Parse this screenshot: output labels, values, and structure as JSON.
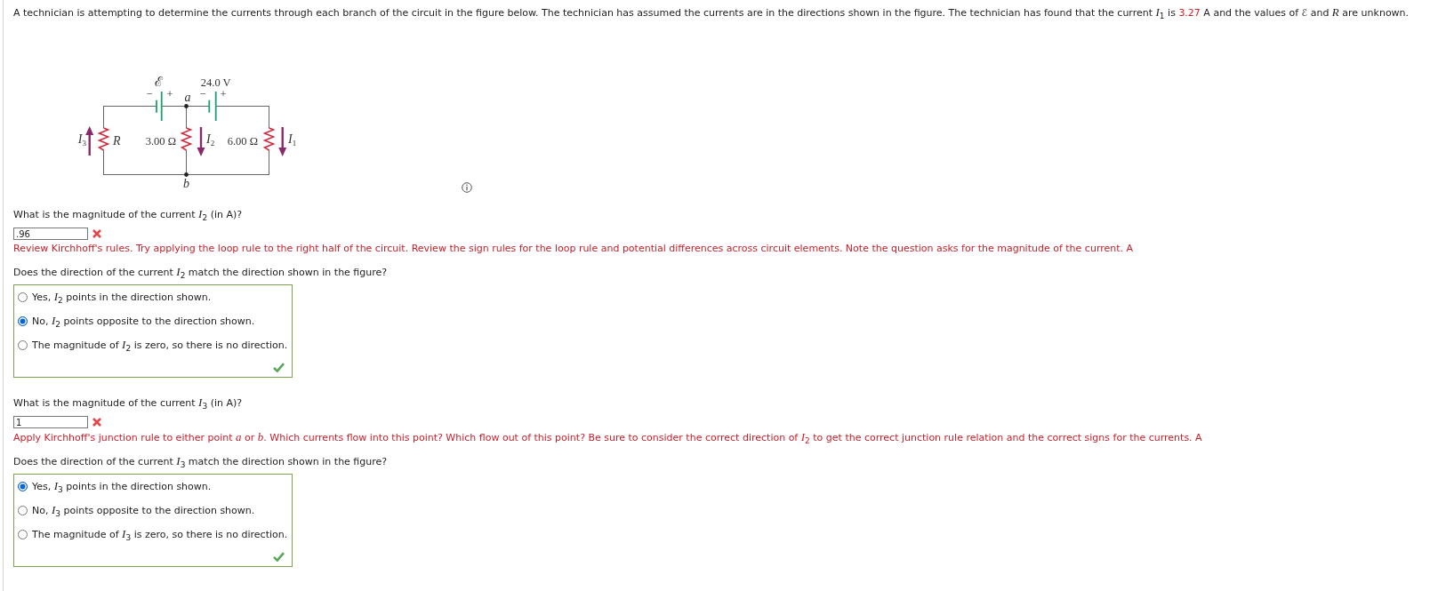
{
  "intro": [
    {
      "kind": "text",
      "text": "A technician is attempting to determine the currents through each branch of the circuit in the figure below. The technician has assumed the currents are in the directions shown in the figure. The technician has found that the current *I*$_{1}$ is "
    },
    {
      "kind": "value",
      "text": "3.27"
    },
    {
      "kind": "text",
      "text": " A and the values of ℰ and *R* are unknown."
    }
  ],
  "circuit": {
    "batteries": [
      {
        "label": "ℰ",
        "minus": "−",
        "plus": "+"
      },
      {
        "label": "24.0 V",
        "minus": "−",
        "plus": "+"
      }
    ],
    "node_labels": [
      "a",
      "b"
    ],
    "branches": [
      {
        "resistor": "R",
        "current": "I$_{3}$",
        "points_up": true
      },
      {
        "resistor": "3.00 Ω",
        "current": "I$_{2}$",
        "points_up": false
      },
      {
        "resistor": "6.00 Ω",
        "current": "I$_{1}$",
        "points_up": false
      }
    ]
  },
  "parts": [
    {
      "kind": "numeric",
      "prompt": "What is the magnitude of the current *I*$_{2}$ (in A)?",
      "answer": ".96",
      "correct": false,
      "feedback": "Review Kirchhoff's rules. Try applying the loop rule to the right half of the circuit. Review the sign rules for the loop rule and potential differences across circuit elements. Note the question asks for the magnitude of the current. A"
    },
    {
      "kind": "choice",
      "prompt": "Does the direction of the current *I*$_{2}$ match the direction shown in the figure?",
      "correct": true,
      "options": [
        {
          "text": "Yes, *I*$_{2}$ points in the direction shown.",
          "selected": false
        },
        {
          "text": "No, *I*$_{2}$ points opposite to the direction shown.",
          "selected": true
        },
        {
          "text": "The magnitude of *I*$_{2}$ is zero, so there is no direction.",
          "selected": false
        }
      ]
    },
    {
      "kind": "numeric",
      "prompt": "What is the magnitude of the current *I*$_{3}$ (in A)?",
      "answer": "1",
      "correct": false,
      "feedback": "Apply Kirchhoff's junction rule to either point *a* or *b*. Which currents flow into this point? Which flow out of this point? Be sure to consider the correct direction of *I*$_{2}$ to get the correct junction rule relation and the correct signs for the currents. A"
    },
    {
      "kind": "choice",
      "prompt": "Does the direction of the current *I*$_{3}$ match the direction shown in the figure?",
      "correct": true,
      "options": [
        {
          "text": "Yes, *I*$_{3}$ points in the direction shown.",
          "selected": true
        },
        {
          "text": "No, *I*$_{3}$ points opposite to the direction shown.",
          "selected": false
        },
        {
          "text": "The magnitude of *I*$_{3}$ is zero, so there is no direction.",
          "selected": false
        }
      ]
    }
  ]
}
